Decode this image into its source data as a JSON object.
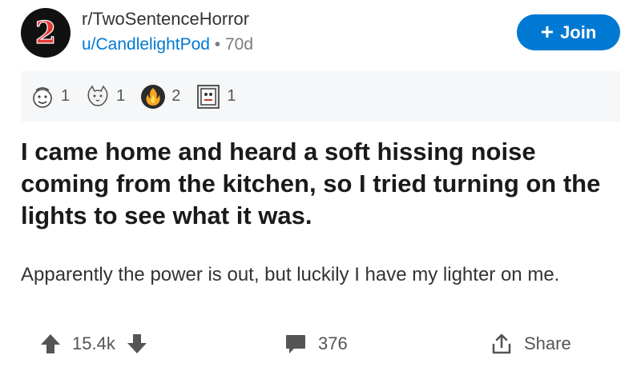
{
  "header": {
    "subreddit_badge": "2",
    "subreddit": "r/TwoSentenceHorror",
    "user": "u/CandlelightPod",
    "separator": "•",
    "age": "70d",
    "join_label": "Join",
    "join_icon": "plus-icon"
  },
  "awards": [
    {
      "icon": "face-award-icon",
      "count": "1"
    },
    {
      "icon": "cat-award-icon",
      "count": "1"
    },
    {
      "icon": "fire-award-icon",
      "count": "2"
    },
    {
      "icon": "door-award-icon",
      "count": "1"
    }
  ],
  "post": {
    "title": "I came home and heard a soft hissing noise coming from the kitchen, so I tried turning on the lights to see what it was.",
    "body": "Apparently the power is out, but luckily I have my lighter on me."
  },
  "actions": {
    "score": "15.4k",
    "comments": "376",
    "share": "Share"
  },
  "colors": {
    "accent": "#0079d3",
    "award_bar": "#f6f7f8",
    "icon_gray": "#555555"
  }
}
